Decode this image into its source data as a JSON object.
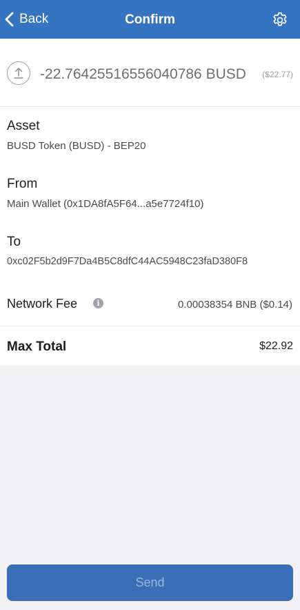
{
  "navbar": {
    "back_label": "Back",
    "title": "Confirm",
    "settings_icon": "gear-icon",
    "back_icon": "chevron-left-icon"
  },
  "transaction": {
    "direction_icon": "upload-arrow-icon",
    "amount": "-22.76425516556040786 BUSD",
    "amount_usd": "($22.77)"
  },
  "details": {
    "asset_label": "Asset",
    "asset_value": "BUSD Token (BUSD) - BEP20",
    "from_label": "From",
    "from_value": "Main Wallet (0x1DA8fA5F64...a5e7724f10)",
    "to_label": "To",
    "to_value": "0xc02F5b2d9F7Da4B5C8dfC44AC5948C23faD380F8",
    "fee_label": "Network Fee",
    "fee_info_icon": "info-icon",
    "fee_value": "0.00038354 BNB ($0.14)",
    "total_label": "Max Total",
    "total_value": "$22.92"
  },
  "actions": {
    "send_label": "Send"
  },
  "colors": {
    "navbar": "#3574c0",
    "send_button": "#3a6fb8",
    "background": "#f2f2f4"
  }
}
